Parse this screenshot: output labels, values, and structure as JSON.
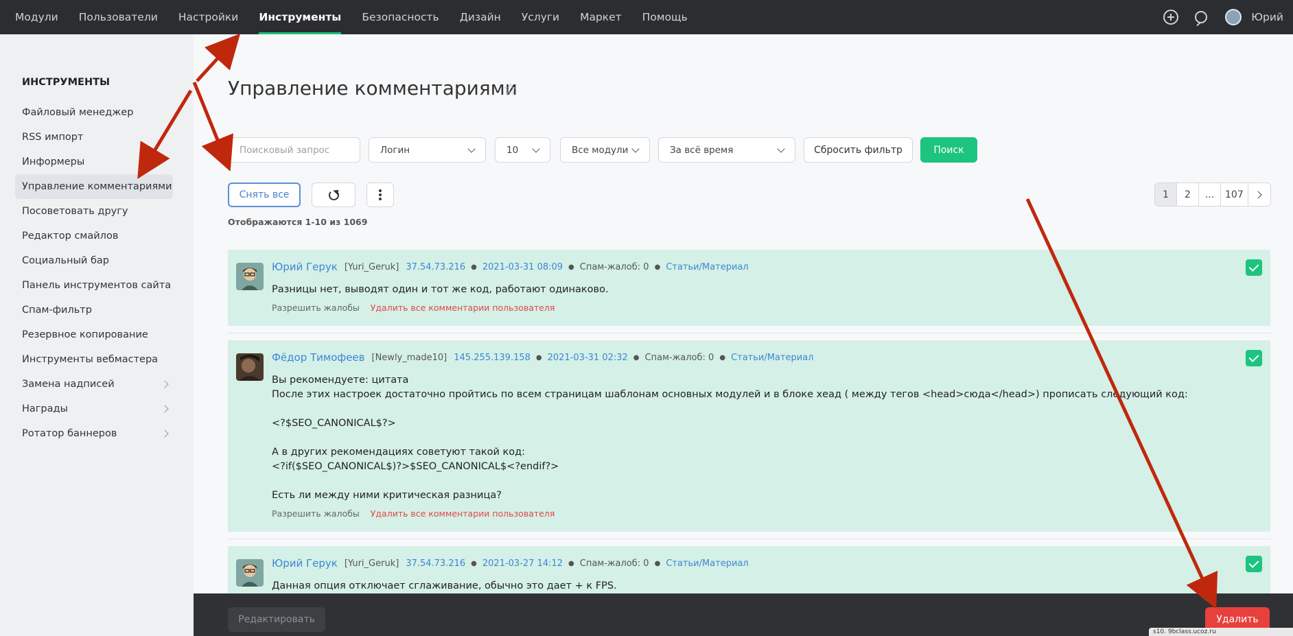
{
  "topnav": {
    "items": [
      "Модули",
      "Пользователи",
      "Настройки",
      "Инструменты",
      "Безопасность",
      "Дизайн",
      "Услуги",
      "Маркет",
      "Помощь"
    ],
    "active_index": 3,
    "user_name": "Юрий"
  },
  "sidebar": {
    "title": "ИНСТРУМЕНТЫ",
    "items": [
      {
        "label": "Файловый менеджер",
        "has_submenu": false
      },
      {
        "label": "RSS импорт",
        "has_submenu": false
      },
      {
        "label": "Информеры",
        "has_submenu": false
      },
      {
        "label": "Управление комментариями",
        "has_submenu": false,
        "active": true
      },
      {
        "label": "Посоветовать другу",
        "has_submenu": false
      },
      {
        "label": "Редактор смайлов",
        "has_submenu": false
      },
      {
        "label": "Социальный бар",
        "has_submenu": false
      },
      {
        "label": "Панель инструментов сайта",
        "has_submenu": false
      },
      {
        "label": "Спам-фильтр",
        "has_submenu": false
      },
      {
        "label": "Резервное копирование",
        "has_submenu": false
      },
      {
        "label": "Инструменты вебмастера",
        "has_submenu": false
      },
      {
        "label": "Замена надписей",
        "has_submenu": true
      },
      {
        "label": "Награды",
        "has_submenu": true
      },
      {
        "label": "Ротатор баннеров",
        "has_submenu": true
      }
    ]
  },
  "page": {
    "title": "Управление комментариями"
  },
  "filters": {
    "search_placeholder": "Поисковый запрос",
    "login_select": "Логин",
    "per_page_select": "10",
    "modules_select": "Все модули",
    "period_select": "За всё время",
    "reset_label": "Сбросить фильтр",
    "search_label": "Поиск"
  },
  "toolbar": {
    "unselect_all_label": "Снять все"
  },
  "summary": {
    "count_text": "Отображаются 1-10 из 1069"
  },
  "pagination": {
    "pages": [
      "1",
      "2",
      "...",
      "107"
    ],
    "active_index": 0
  },
  "comments": [
    {
      "author": "Юрий Герук",
      "login": "[Yuri_Geruk]",
      "ip": "37.54.73.216",
      "datetime": "2021-03-31 08:09",
      "spam": "Спам-жалоб: 0",
      "category": "Статьи/Материал",
      "text": "Разницы нет, выводят один и тот же код, работают одинаково.",
      "allow_label": "Разрешить жалобы",
      "delete_all_label": "Удалить все комментарии пользователя",
      "checked": true
    },
    {
      "author": "Фёдор Тимофеев",
      "login": "[Newly_made10]",
      "ip": "145.255.139.158",
      "datetime": "2021-03-31 02:32",
      "spam": "Спам-жалоб: 0",
      "category": "Статьи/Материал",
      "text": "Вы рекомендуете: цитата\nПосле этих настроек достаточно пройтись по всем страницам шаблонам основных модулей и в блоке хеад ( между тегов <head>сюда</head>) прописать следующий код:\n\n<?$SEO_CANONICAL$?>\n\nА в других рекомендациях советуют такой код:\n<?if($SEO_CANONICAL$)?>$SEO_CANONICAL$<?endif?>\n\nЕсть ли между ними критическая разница?",
      "allow_label": "Разрешить жалобы",
      "delete_all_label": "Удалить все комментарии пользователя",
      "checked": true
    },
    {
      "author": "Юрий Герук",
      "login": "[Yuri_Geruk]",
      "ip": "37.54.73.216",
      "datetime": "2021-03-27 14:12",
      "spam": "Спам-жалоб: 0",
      "category": "Статьи/Материал",
      "text": "Данная опция отключает сглаживание, обычно это дает + к FPS.",
      "checked": true
    }
  ],
  "bottombar": {
    "edit_label": "Редактировать",
    "delete_label": "Удалить",
    "status_text": "s10. 9bclass.ucoz.ru"
  },
  "colors": {
    "accent_green": "#1dc47f",
    "link_blue": "#3d86d8",
    "danger_red": "#e8403d",
    "comment_bg": "#d5f0e6",
    "arrow_red": "#c0280e"
  }
}
